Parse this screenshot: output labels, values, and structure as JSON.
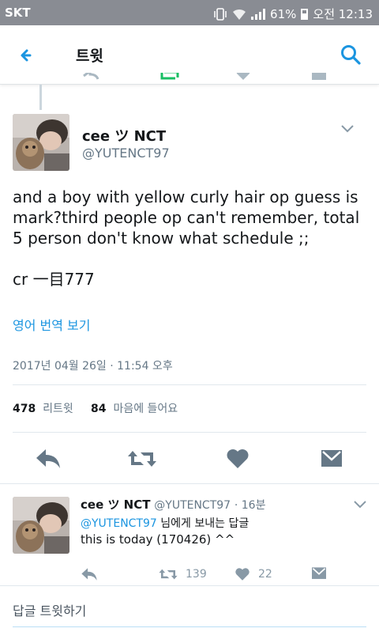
{
  "status_bar": {
    "carrier": "SKT",
    "battery": "61%",
    "time": "오전 12:13"
  },
  "app_bar": {
    "title": "트윗"
  },
  "main_tweet": {
    "display_name": "cee ツ NCT",
    "handle": "@YUTENCT97",
    "text": "and a boy with yellow curly hair op guess is mark?third people op can't remember, total 5 person don't know what schedule ;;\n\ncr 一目777",
    "translate_label": "영어 번역 보기",
    "timestamp": "2017년 04월 26일 · 11:54 오후",
    "retweet_count": "478",
    "retweet_label": "리트윗",
    "like_count": "84",
    "like_label": "마음에 들어요"
  },
  "reply_tweet": {
    "display_name": "cee ツ NCT",
    "handle": "@YUTENCT97",
    "time": "· 16분",
    "mention": "@YUTENCT97",
    "reply_to_label": "님에게 보내는 답글",
    "text": "this is today (170426) ^^",
    "retweet_count": "139",
    "like_count": "22"
  },
  "compose": {
    "placeholder": "답글 트윗하기"
  },
  "colors": {
    "accent": "#1b95e0",
    "icon": "#657786",
    "status_bar": "#898c93"
  }
}
